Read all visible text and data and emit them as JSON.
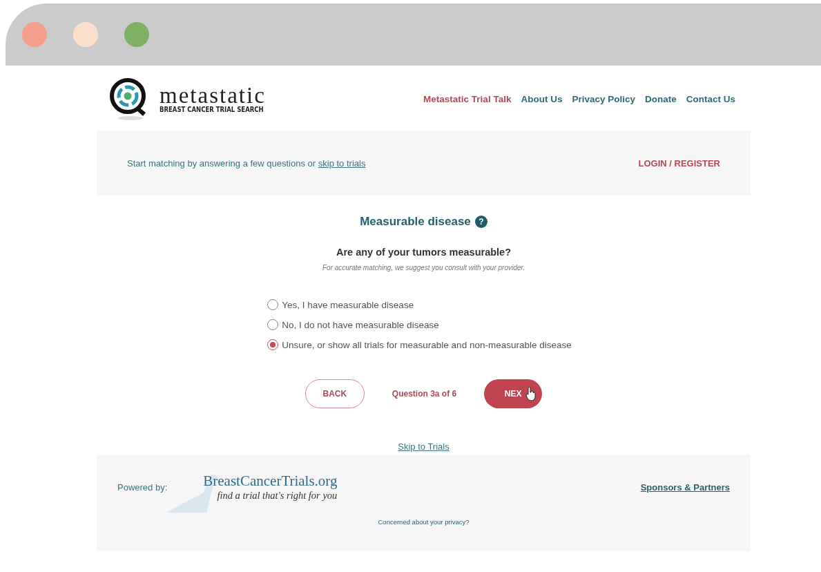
{
  "window": {
    "controls": [
      {
        "color": "#f4a08a"
      },
      {
        "color": "#fde0cc"
      },
      {
        "color": "#7db062"
      }
    ]
  },
  "logo": {
    "title": "metastatic",
    "subtitle": "BREAST CANCER TRIAL SEARCH"
  },
  "nav": [
    {
      "label": "Metastatic Trial Talk",
      "highlighted": true
    },
    {
      "label": "About Us",
      "highlighted": false
    },
    {
      "label": "Privacy Policy",
      "highlighted": false
    },
    {
      "label": "Donate",
      "highlighted": false
    },
    {
      "label": "Contact Us",
      "highlighted": false
    }
  ],
  "banner": {
    "text": "Start matching by answering a few questions or",
    "link": "skip to trials",
    "login": "LOGIN / REGISTER"
  },
  "question": {
    "topic": "Measurable disease",
    "help": "?",
    "prompt": "Are any of your tumors measurable?",
    "hint": "For accurate matching, we suggest you consult with your provider.",
    "options": [
      {
        "label": "Yes, I have measurable disease",
        "selected": false
      },
      {
        "label": "No, I do not have measurable disease",
        "selected": false
      },
      {
        "label": "Unsure, or show all trials for measurable and non-measurable disease",
        "selected": true
      }
    ]
  },
  "steps": {
    "back": "BACK",
    "progress": "Question 3a of 6",
    "next": "NEX"
  },
  "skip_link": "Skip to Trials",
  "footer": {
    "powered_by": "Powered by:",
    "partner_name": "BreastCancerTrials.org",
    "partner_tagline": "find a trial that's right for you",
    "sponsors": "Sponsors & Partners",
    "privacy": "Concerned about your privacy?"
  }
}
